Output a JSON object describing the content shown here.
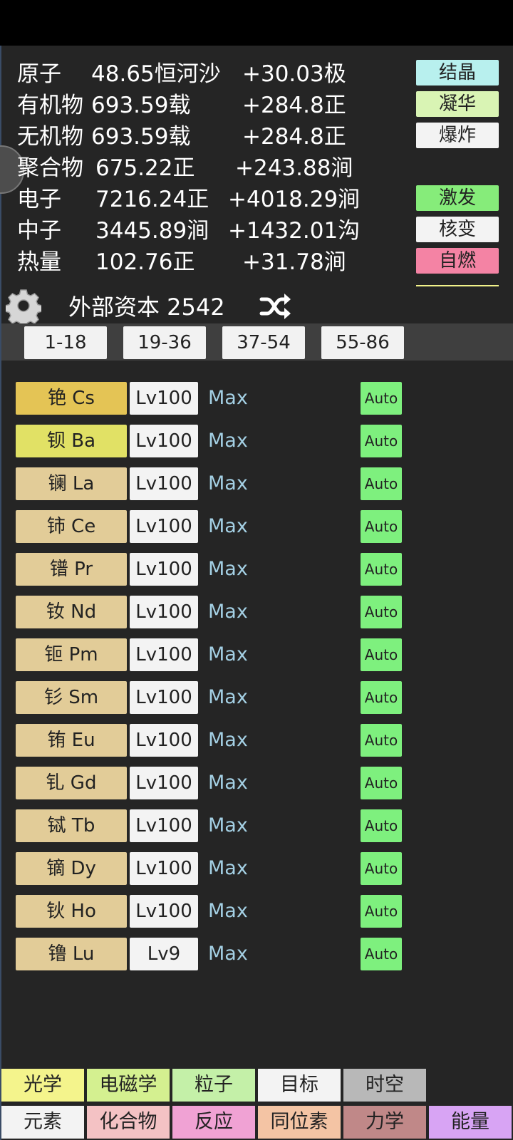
{
  "resources": [
    {
      "name": "原子",
      "amount": "48.65恒河沙",
      "rate": "+30.03极"
    },
    {
      "name": "有机物",
      "amount": "693.59载",
      "rate": "+284.8正"
    },
    {
      "name": "无机物",
      "amount": "693.59载",
      "rate": "+284.8正"
    },
    {
      "name": "聚合物",
      "amount": "675.22正",
      "rate": "+243.88涧"
    },
    {
      "name": "电子",
      "amount": "7216.24正",
      "rate": "+4018.29涧"
    },
    {
      "name": "中子",
      "amount": "3445.89涧",
      "rate": "+1432.01沟"
    },
    {
      "name": "热量",
      "amount": "102.76正",
      "rate": "+31.78涧"
    }
  ],
  "side_buttons": [
    {
      "label": "结晶",
      "color": "#b8f0ee"
    },
    {
      "label": "凝华",
      "color": "#d9f4b4"
    },
    {
      "label": "爆炸",
      "color": "#f3f3f3"
    },
    {
      "label": "激发",
      "color": "#86ec7a"
    },
    {
      "label": "核变",
      "color": "#f3f3f3"
    },
    {
      "label": "自燃",
      "color": "#f483a4"
    }
  ],
  "capital": {
    "label": "外部资本 2542"
  },
  "icons": {
    "settings": "gear-icon",
    "shuffle": "shuffle-icon"
  },
  "page_tabs": [
    "1-18",
    "19-36",
    "37-54",
    "55-86"
  ],
  "elements": [
    {
      "name": "铯 Cs",
      "level": "Lv100",
      "status": "Max",
      "auto": "Auto",
      "color": "#e4c455"
    },
    {
      "name": "钡 Ba",
      "level": "Lv100",
      "status": "Max",
      "auto": "Auto",
      "color": "#e1e165"
    },
    {
      "name": "镧 La",
      "level": "Lv100",
      "status": "Max",
      "auto": "Auto",
      "color": "#e2cc98"
    },
    {
      "name": "铈 Ce",
      "level": "Lv100",
      "status": "Max",
      "auto": "Auto",
      "color": "#e2cc98"
    },
    {
      "name": "镨 Pr",
      "level": "Lv100",
      "status": "Max",
      "auto": "Auto",
      "color": "#e2cc98"
    },
    {
      "name": "钕 Nd",
      "level": "Lv100",
      "status": "Max",
      "auto": "Auto",
      "color": "#e2cc98"
    },
    {
      "name": "钷 Pm",
      "level": "Lv100",
      "status": "Max",
      "auto": "Auto",
      "color": "#e2cc98"
    },
    {
      "name": "钐 Sm",
      "level": "Lv100",
      "status": "Max",
      "auto": "Auto",
      "color": "#e2cc98"
    },
    {
      "name": "铕 Eu",
      "level": "Lv100",
      "status": "Max",
      "auto": "Auto",
      "color": "#e2cc98"
    },
    {
      "name": "钆 Gd",
      "level": "Lv100",
      "status": "Max",
      "auto": "Auto",
      "color": "#e2cc98"
    },
    {
      "name": "铽 Tb",
      "level": "Lv100",
      "status": "Max",
      "auto": "Auto",
      "color": "#e2cc98"
    },
    {
      "name": "镝 Dy",
      "level": "Lv100",
      "status": "Max",
      "auto": "Auto",
      "color": "#e2cc98"
    },
    {
      "name": "钬 Ho",
      "level": "Lv100",
      "status": "Max",
      "auto": "Auto",
      "color": "#e2cc98"
    },
    {
      "name": "镥 Lu",
      "level": "Lv9",
      "status": "Max",
      "auto": "Auto",
      "color": "#e2cc98"
    }
  ],
  "nav_row1": [
    {
      "label": "光学",
      "color": "#f4f48c"
    },
    {
      "label": "电磁学",
      "color": "#d4f090"
    },
    {
      "label": "粒子",
      "color": "#c4f0a8"
    },
    {
      "label": "目标",
      "color": "#f3f3f3"
    },
    {
      "label": "时空",
      "color": "#b8b8b8"
    }
  ],
  "nav_row2": [
    {
      "label": "元素",
      "color": "#f3f3f3"
    },
    {
      "label": "化合物",
      "color": "#f4c2c4"
    },
    {
      "label": "反应",
      "color": "#f0a2d4"
    },
    {
      "label": "同位素",
      "color": "#f4c4a4"
    },
    {
      "label": "力学",
      "color": "#c08888"
    },
    {
      "label": "能量",
      "color": "#d8a4f4"
    }
  ]
}
